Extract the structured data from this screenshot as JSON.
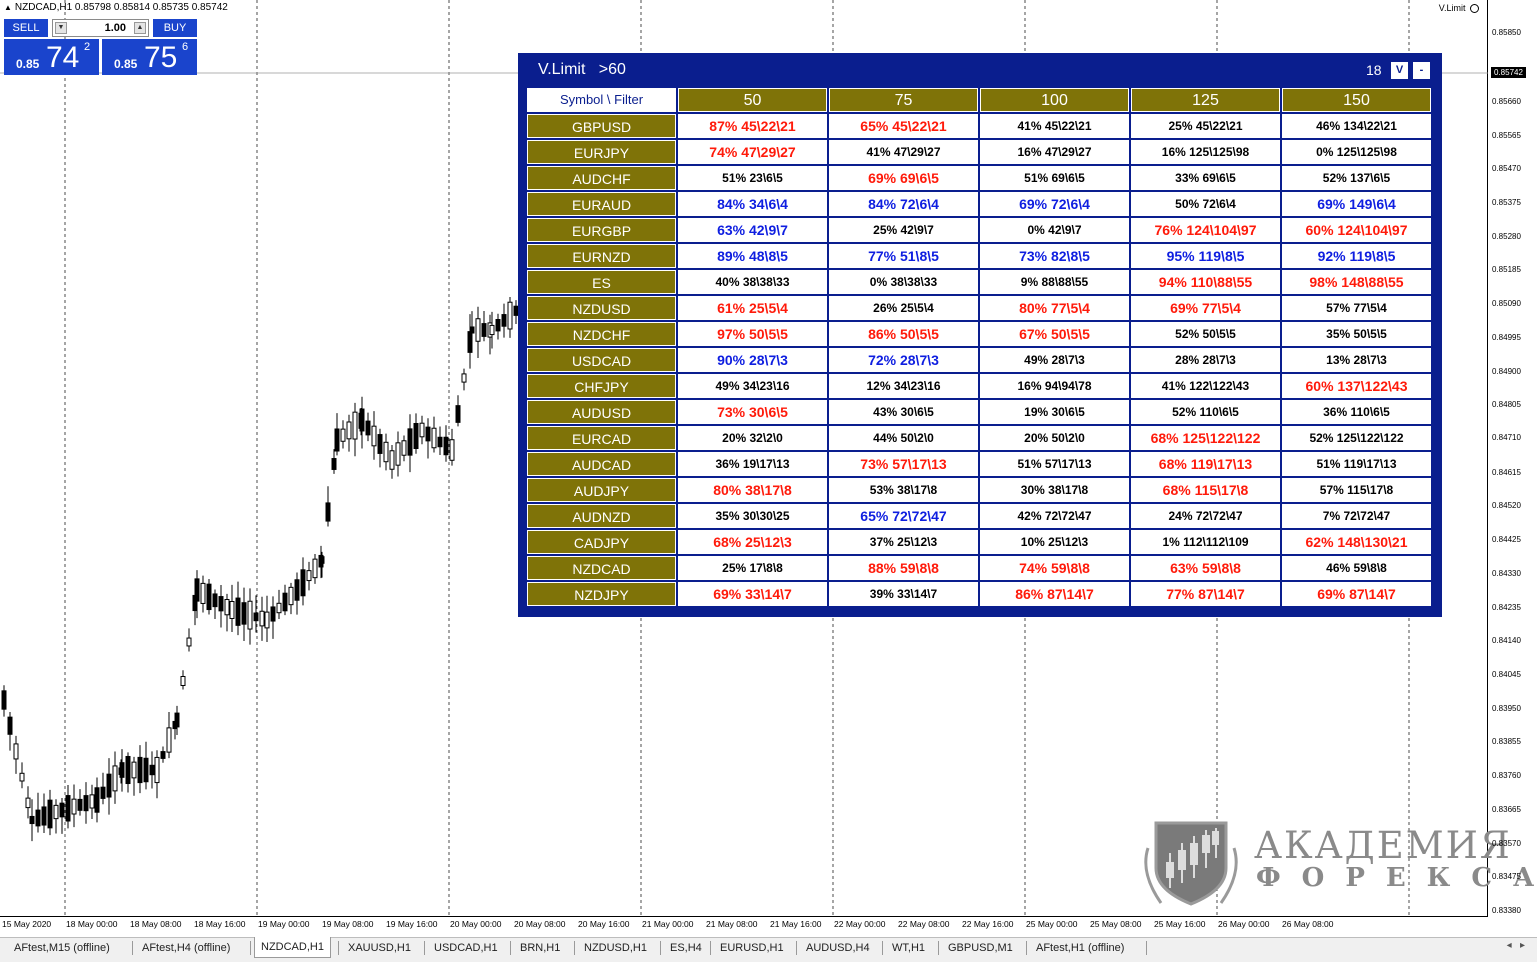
{
  "chart": {
    "title": "NZDCAD,H1  0.85798 0.85814 0.85735 0.85742",
    "ea_name": "V.Limit"
  },
  "one_click": {
    "sell_label": "SELL",
    "buy_label": "BUY",
    "lot": "1.00",
    "sell_price_small": "0.85",
    "sell_price_big": "74",
    "sell_price_sup": "2",
    "buy_price_small": "0.85",
    "buy_price_big": "75",
    "buy_price_sup": "6"
  },
  "price_axis": {
    "labels": [
      "0.85850",
      "0.85742",
      "0.85660",
      "0.85565",
      "0.85470",
      "0.85375",
      "0.85280",
      "0.85185",
      "0.85090",
      "0.84995",
      "0.84900",
      "0.84805",
      "0.84710",
      "0.84615",
      "0.84520",
      "0.84425",
      "0.84330",
      "0.84235",
      "0.84140",
      "0.84045",
      "0.83950",
      "0.83855",
      "0.83760",
      "0.83665",
      "0.83570",
      "0.83475",
      "0.83380"
    ],
    "current": "0.85742"
  },
  "time_axis": {
    "labels": [
      "15 May 2020",
      "18 May 00:00",
      "18 May 08:00",
      "18 May 16:00",
      "19 May 00:00",
      "19 May 08:00",
      "19 May 16:00",
      "20 May 00:00",
      "20 May 08:00",
      "20 May 16:00",
      "21 May 00:00",
      "21 May 08:00",
      "21 May 16:00",
      "22 May 00:00",
      "22 May 08:00",
      "22 May 16:00",
      "25 May 00:00",
      "25 May 08:00",
      "25 May 16:00",
      "26 May 00:00",
      "26 May 08:00"
    ]
  },
  "tabs": [
    {
      "label": "AFtest,M15 (offline)"
    },
    {
      "label": "AFtest,H4 (offline)"
    },
    {
      "label": "NZDCAD,H1",
      "active": true
    },
    {
      "label": "XAUUSD,H1"
    },
    {
      "label": "USDCAD,H1"
    },
    {
      "label": "BRN,H1"
    },
    {
      "label": "NZDUSD,H1"
    },
    {
      "label": "ES,H4"
    },
    {
      "label": "EURUSD,H1"
    },
    {
      "label": "AUDUSD,H4"
    },
    {
      "label": "WT,H1"
    },
    {
      "label": "GBPUSD,M1"
    },
    {
      "label": "AFtest,H1 (offline)"
    }
  ],
  "vlimit": {
    "title": "V.Limit",
    "filter": ">60",
    "count": "18",
    "btn_v": "V",
    "btn_min": "-",
    "corner": "Symbol \\ Filter",
    "columns": [
      "50",
      "75",
      "100",
      "125",
      "150"
    ],
    "colors": {
      "red": "#ff1a0a",
      "blue": "#0e1ee0",
      "black": "#000000",
      "header": "#7f7308",
      "panel": "#0a1e8e"
    },
    "rows": [
      {
        "symbol": "GBPUSD",
        "cells": [
          [
            "87% 45\\22\\21",
            "red"
          ],
          [
            "65% 45\\22\\21",
            "red"
          ],
          [
            "41% 45\\22\\21",
            "black"
          ],
          [
            "25% 45\\22\\21",
            "black"
          ],
          [
            "46% 134\\22\\21",
            "black"
          ]
        ]
      },
      {
        "symbol": "EURJPY",
        "cells": [
          [
            "74% 47\\29\\27",
            "red"
          ],
          [
            "41% 47\\29\\27",
            "black"
          ],
          [
            "16% 47\\29\\27",
            "black"
          ],
          [
            "16% 125\\125\\98",
            "black"
          ],
          [
            "0% 125\\125\\98",
            "black"
          ]
        ]
      },
      {
        "symbol": "AUDCHF",
        "cells": [
          [
            "51% 23\\6\\5",
            "black"
          ],
          [
            "69% 69\\6\\5",
            "red"
          ],
          [
            "51% 69\\6\\5",
            "black"
          ],
          [
            "33% 69\\6\\5",
            "black"
          ],
          [
            "52% 137\\6\\5",
            "black"
          ]
        ]
      },
      {
        "symbol": "EURAUD",
        "cells": [
          [
            "84% 34\\6\\4",
            "blue"
          ],
          [
            "84% 72\\6\\4",
            "blue"
          ],
          [
            "69% 72\\6\\4",
            "blue"
          ],
          [
            "50% 72\\6\\4",
            "black"
          ],
          [
            "69% 149\\6\\4",
            "blue"
          ]
        ]
      },
      {
        "symbol": "EURGBP",
        "cells": [
          [
            "63% 42\\9\\7",
            "blue"
          ],
          [
            "25% 42\\9\\7",
            "black"
          ],
          [
            "0% 42\\9\\7",
            "black"
          ],
          [
            "76% 124\\104\\97",
            "red"
          ],
          [
            "60% 124\\104\\97",
            "red"
          ]
        ]
      },
      {
        "symbol": "EURNZD",
        "cells": [
          [
            "89% 48\\8\\5",
            "blue"
          ],
          [
            "77% 51\\8\\5",
            "blue"
          ],
          [
            "73% 82\\8\\5",
            "blue"
          ],
          [
            "95% 119\\8\\5",
            "blue"
          ],
          [
            "92% 119\\8\\5",
            "blue"
          ]
        ]
      },
      {
        "symbol": "ES",
        "cells": [
          [
            "40% 38\\38\\33",
            "black"
          ],
          [
            "0% 38\\38\\33",
            "black"
          ],
          [
            "9% 88\\88\\55",
            "black"
          ],
          [
            "94% 110\\88\\55",
            "red"
          ],
          [
            "98% 148\\88\\55",
            "red"
          ]
        ]
      },
      {
        "symbol": "NZDUSD",
        "cells": [
          [
            "61% 25\\5\\4",
            "red"
          ],
          [
            "26% 25\\5\\4",
            "black"
          ],
          [
            "80% 77\\5\\4",
            "red"
          ],
          [
            "69% 77\\5\\4",
            "red"
          ],
          [
            "57% 77\\5\\4",
            "black"
          ]
        ]
      },
      {
        "symbol": "NZDCHF",
        "cells": [
          [
            "97% 50\\5\\5",
            "red"
          ],
          [
            "86% 50\\5\\5",
            "red"
          ],
          [
            "67% 50\\5\\5",
            "red"
          ],
          [
            "52% 50\\5\\5",
            "black"
          ],
          [
            "35% 50\\5\\5",
            "black"
          ]
        ]
      },
      {
        "symbol": "USDCAD",
        "cells": [
          [
            "90% 28\\7\\3",
            "blue"
          ],
          [
            "72% 28\\7\\3",
            "blue"
          ],
          [
            "49% 28\\7\\3",
            "black"
          ],
          [
            "28% 28\\7\\3",
            "black"
          ],
          [
            "13% 28\\7\\3",
            "black"
          ]
        ]
      },
      {
        "symbol": "CHFJPY",
        "cells": [
          [
            "49% 34\\23\\16",
            "black"
          ],
          [
            "12% 34\\23\\16",
            "black"
          ],
          [
            "16% 94\\94\\78",
            "black"
          ],
          [
            "41% 122\\122\\43",
            "black"
          ],
          [
            "60% 137\\122\\43",
            "red"
          ]
        ]
      },
      {
        "symbol": "AUDUSD",
        "cells": [
          [
            "73% 30\\6\\5",
            "red"
          ],
          [
            "43% 30\\6\\5",
            "black"
          ],
          [
            "19% 30\\6\\5",
            "black"
          ],
          [
            "52% 110\\6\\5",
            "black"
          ],
          [
            "36% 110\\6\\5",
            "black"
          ]
        ]
      },
      {
        "symbol": "EURCAD",
        "cells": [
          [
            "20% 32\\2\\0",
            "black"
          ],
          [
            "44% 50\\2\\0",
            "black"
          ],
          [
            "20% 50\\2\\0",
            "black"
          ],
          [
            "68% 125\\122\\122",
            "red"
          ],
          [
            "52% 125\\122\\122",
            "black"
          ]
        ]
      },
      {
        "symbol": "AUDCAD",
        "cells": [
          [
            "36% 19\\17\\13",
            "black"
          ],
          [
            "73% 57\\17\\13",
            "red"
          ],
          [
            "51% 57\\17\\13",
            "black"
          ],
          [
            "68% 119\\17\\13",
            "red"
          ],
          [
            "51% 119\\17\\13",
            "black"
          ]
        ]
      },
      {
        "symbol": "AUDJPY",
        "cells": [
          [
            "80% 38\\17\\8",
            "red"
          ],
          [
            "53% 38\\17\\8",
            "black"
          ],
          [
            "30% 38\\17\\8",
            "black"
          ],
          [
            "68% 115\\17\\8",
            "red"
          ],
          [
            "57% 115\\17\\8",
            "black"
          ]
        ]
      },
      {
        "symbol": "AUDNZD",
        "cells": [
          [
            "35% 30\\30\\25",
            "black"
          ],
          [
            "65% 72\\72\\47",
            "blue"
          ],
          [
            "42% 72\\72\\47",
            "black"
          ],
          [
            "24% 72\\72\\47",
            "black"
          ],
          [
            "7% 72\\72\\47",
            "black"
          ]
        ]
      },
      {
        "symbol": "CADJPY",
        "cells": [
          [
            "68% 25\\12\\3",
            "red"
          ],
          [
            "37% 25\\12\\3",
            "black"
          ],
          [
            "10% 25\\12\\3",
            "black"
          ],
          [
            "1% 112\\112\\109",
            "black"
          ],
          [
            "62% 148\\130\\21",
            "red"
          ]
        ]
      },
      {
        "symbol": "NZDCAD",
        "cells": [
          [
            "25% 17\\8\\8",
            "black"
          ],
          [
            "88% 59\\8\\8",
            "red"
          ],
          [
            "74% 59\\8\\8",
            "red"
          ],
          [
            "63% 59\\8\\8",
            "red"
          ],
          [
            "46% 59\\8\\8",
            "black"
          ]
        ]
      },
      {
        "symbol": "NZDJPY",
        "cells": [
          [
            "69% 33\\14\\7",
            "red"
          ],
          [
            "39% 33\\14\\7",
            "black"
          ],
          [
            "86% 87\\14\\7",
            "red"
          ],
          [
            "77% 87\\14\\7",
            "red"
          ],
          [
            "69% 87\\14\\7",
            "red"
          ]
        ]
      }
    ]
  },
  "logo": {
    "line1": "АКАДЕМИЯ",
    "line2": "ФОРЕКСА"
  }
}
